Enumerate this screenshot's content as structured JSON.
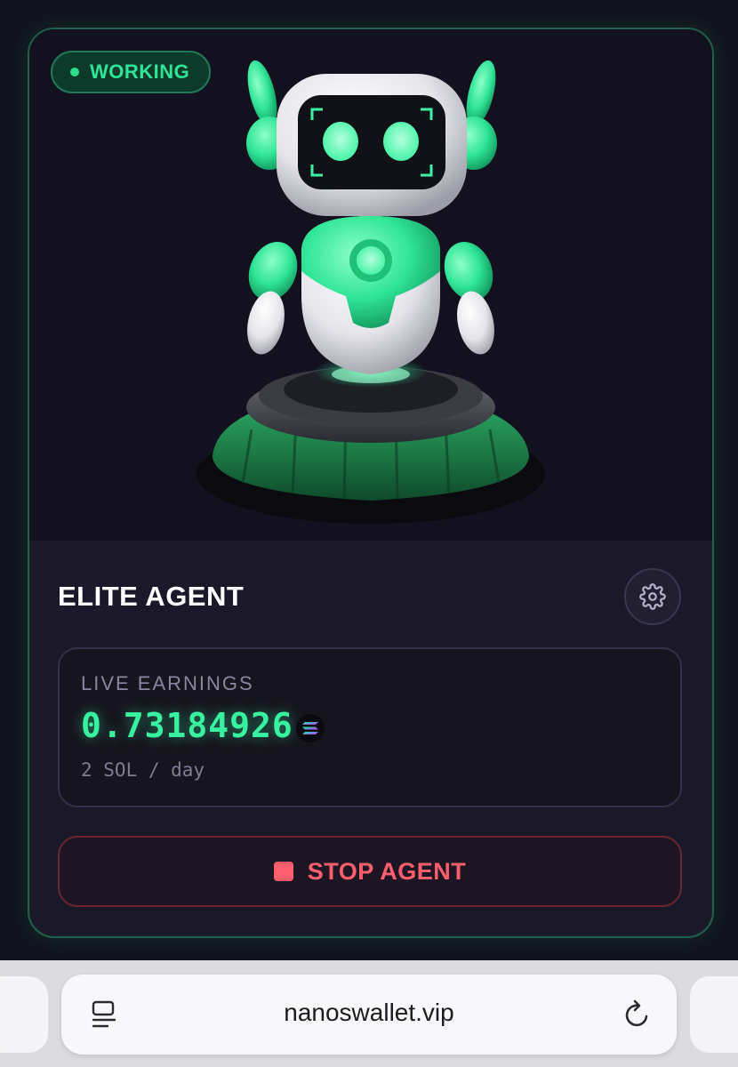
{
  "agent_card": {
    "status_label": "WORKING",
    "title": "ELITE AGENT",
    "earnings": {
      "label": "LIVE EARNINGS",
      "value": "0.73184926",
      "currency_icon": "solana-icon",
      "rate": "2 SOL / day"
    },
    "stop_button_label": "STOP AGENT",
    "colors": {
      "accent_green": "#2fe596",
      "stop_red": "#ff5f6d",
      "card_border": "#1f5f4b"
    },
    "icons": {
      "status": "status-dot",
      "settings": "gear-icon",
      "stop": "stop-square-icon",
      "hero": "robot-illustration"
    }
  },
  "browser": {
    "url": "nanoswallet.vip",
    "icons": {
      "left": "tab-overview-icon",
      "right": "reload-icon"
    }
  }
}
